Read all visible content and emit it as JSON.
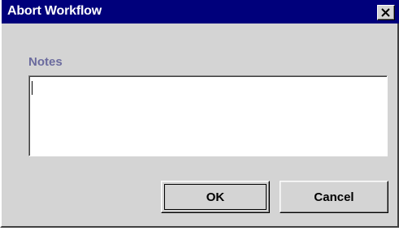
{
  "window": {
    "title": "Abort Workflow",
    "close_icon": "close-icon"
  },
  "form": {
    "notes_label": "Notes",
    "notes_value": "",
    "notes_placeholder": ""
  },
  "buttons": {
    "ok_label": "OK",
    "cancel_label": "Cancel"
  },
  "colors": {
    "titlebar": "#00007b",
    "dialog_background": "#d4d4d4",
    "label": "#6b6b9e"
  }
}
